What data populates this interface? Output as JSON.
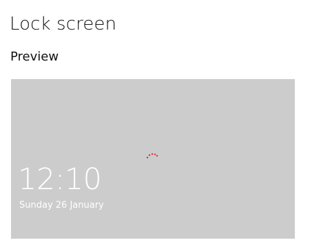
{
  "page": {
    "title": "Lock screen"
  },
  "preview": {
    "heading": "Preview",
    "background_color": "#cccccc",
    "time": "12:10",
    "date": "Sunday 26 January",
    "loading_indicator": {
      "icon": "loading-spinner-icon",
      "color": "#d13438"
    }
  }
}
